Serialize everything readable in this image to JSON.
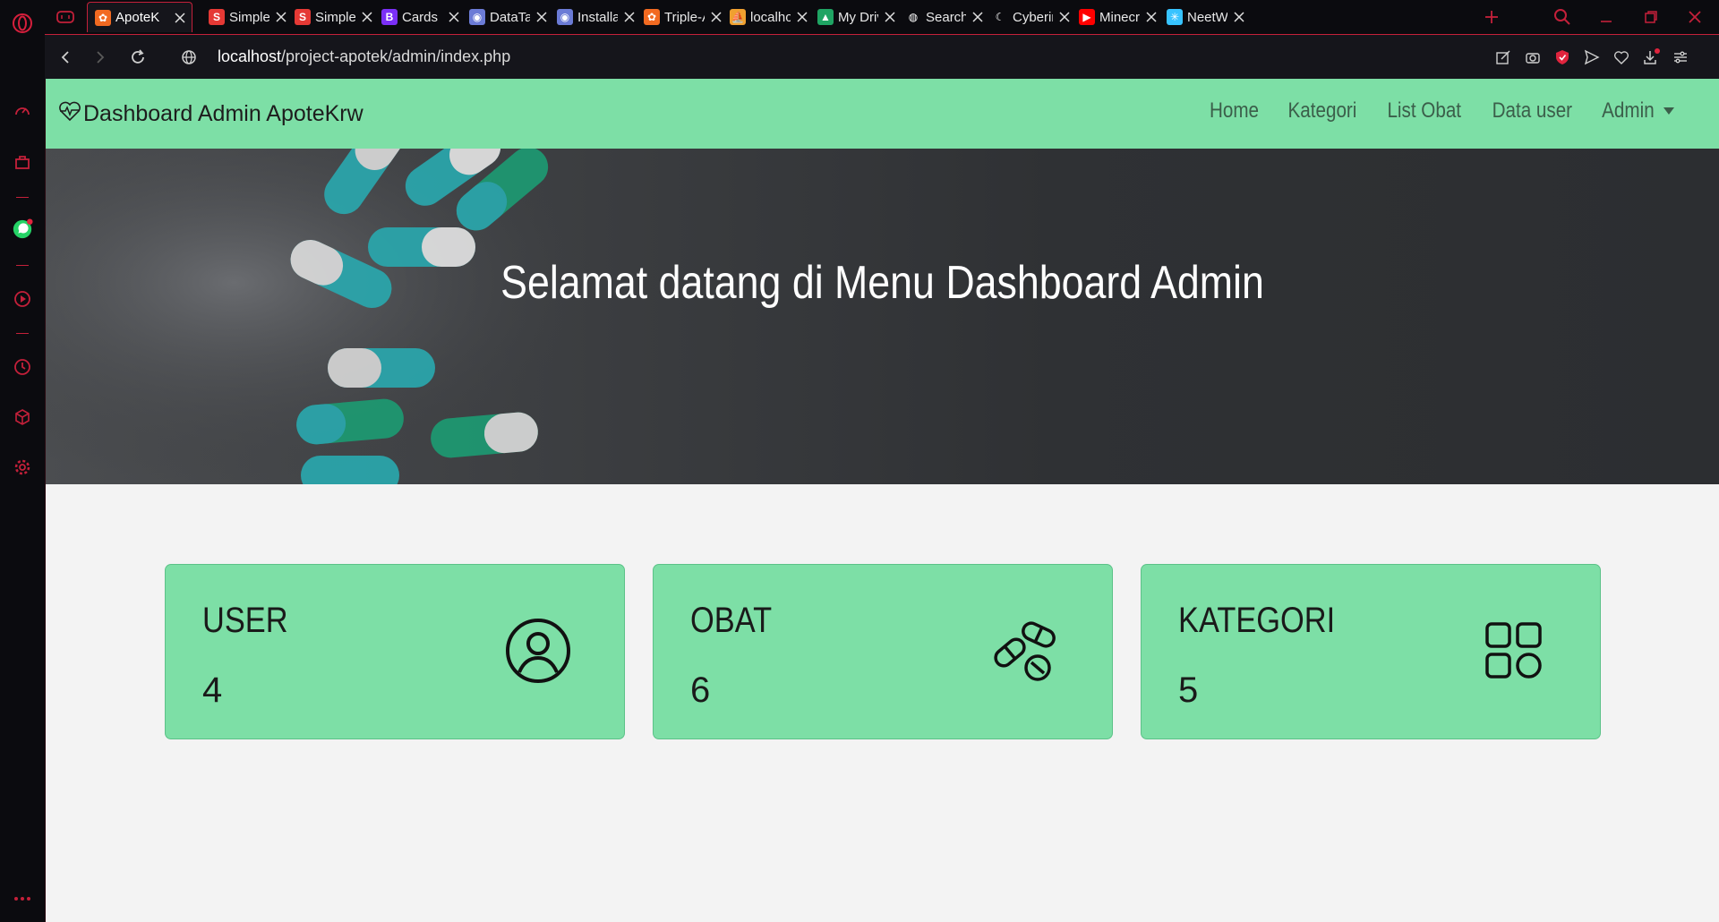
{
  "browser": {
    "tabs": [
      {
        "label": "ApoteK",
        "favicon": "xampp-icon",
        "color": "#f26a21",
        "active": true
      },
      {
        "label": "Simple",
        "favicon": "s-logo-icon",
        "color": "#e53935",
        "active": false
      },
      {
        "label": "Simple",
        "favicon": "s-logo-icon",
        "color": "#e53935",
        "active": false
      },
      {
        "label": "Cards ·",
        "favicon": "bootstrap-icon",
        "color": "#7b2ff7",
        "active": false
      },
      {
        "label": "DataTab",
        "favicon": "datatables-icon",
        "color": "#6b7bd6",
        "active": false
      },
      {
        "label": "Installat",
        "favicon": "installation-icon",
        "color": "#6b7bd6",
        "active": false
      },
      {
        "label": "Triple-A",
        "favicon": "xampp-icon",
        "color": "#f26a21",
        "active": false
      },
      {
        "label": "localhos",
        "favicon": "phpmyadmin-icon",
        "color": "#f0a030",
        "active": false
      },
      {
        "label": "My Driv",
        "favicon": "google-drive-icon",
        "color": "#1fa463",
        "active": false
      },
      {
        "label": "Search",
        "favicon": "globe-icon",
        "color": "#ffffff",
        "active": false
      },
      {
        "label": "Cyberin",
        "favicon": "cyber-icon",
        "color": "#ffffff",
        "active": false
      },
      {
        "label": "Minecra",
        "favicon": "youtube-icon",
        "color": "#ff0000",
        "active": false
      },
      {
        "label": "NeetWo",
        "favicon": "neetwork-icon",
        "color": "#37c3ff",
        "active": false
      }
    ],
    "url_host": "localhost",
    "url_path": "/project-apotek/admin/index.php",
    "accent": "#c4203a"
  },
  "page": {
    "brand": "Dashboard Admin ApoteKrw",
    "nav": {
      "home": "Home",
      "kategori": "Kategori",
      "list_obat": "List Obat",
      "data_user": "Data user",
      "admin": "Admin"
    },
    "hero_title": "Selamat datang di Menu Dashboard Admin",
    "cards": [
      {
        "title": "USER",
        "count": "4",
        "icon": "user-circle-icon"
      },
      {
        "title": "OBAT",
        "count": "6",
        "icon": "pills-icon"
      },
      {
        "title": "KATEGORI",
        "count": "5",
        "icon": "grid-icon"
      }
    ],
    "colors": {
      "navbar": "#7ddfa6",
      "card": "#7ddfa6",
      "background": "#f3f3f3"
    }
  }
}
